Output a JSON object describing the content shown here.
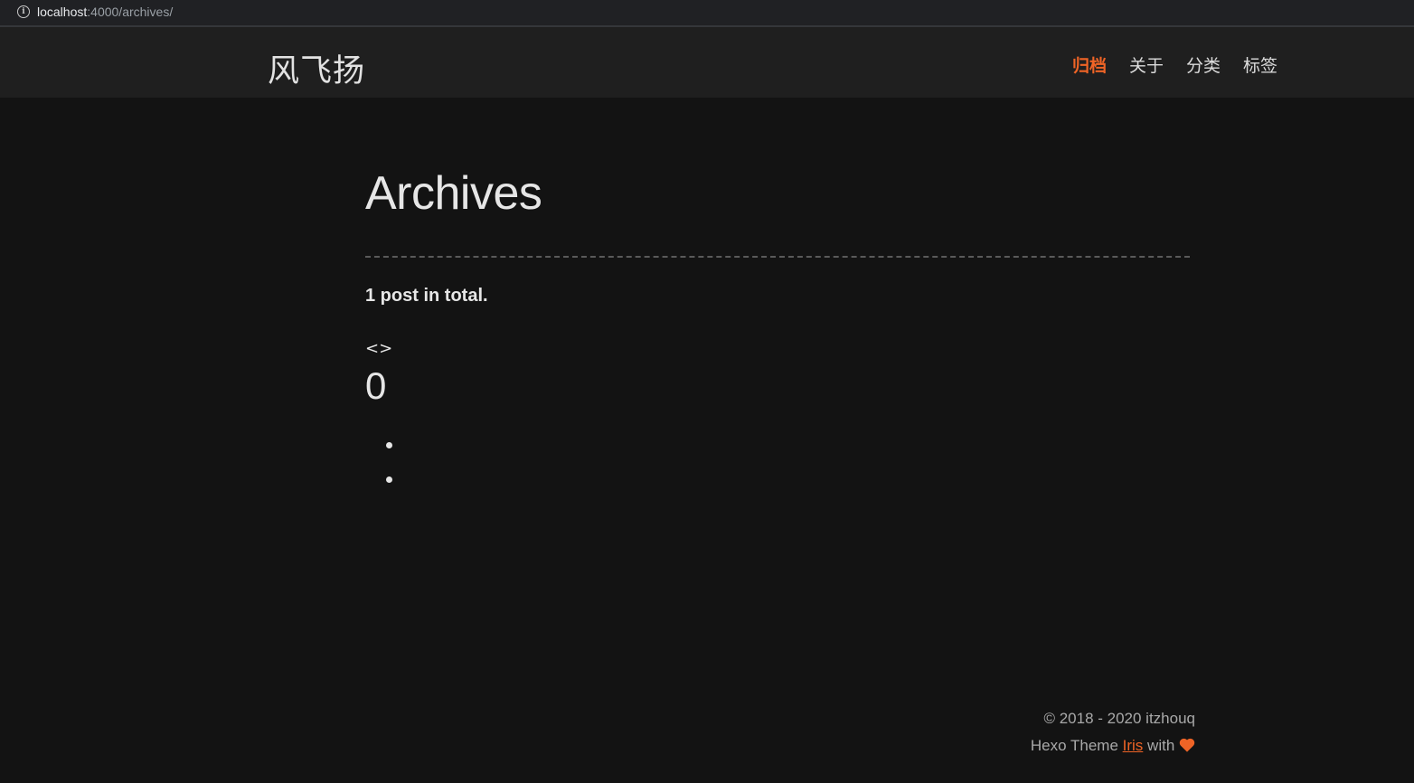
{
  "browser": {
    "url_host": "localhost",
    "url_rest": ":4000/archives/"
  },
  "header": {
    "site_title": "风飞扬",
    "nav": [
      {
        "label": "归档",
        "active": true
      },
      {
        "label": "关于",
        "active": false
      },
      {
        "label": "分类",
        "active": false
      },
      {
        "label": "标签",
        "active": false
      }
    ]
  },
  "main": {
    "title": "Archives",
    "total": "1 post in total.",
    "year_marker": "<>",
    "year_count": "0",
    "posts": [
      "",
      ""
    ]
  },
  "footer": {
    "copyright": "© 2018 - 2020 itzhouq",
    "theme_prefix": "Hexo Theme ",
    "theme_link": "Iris",
    "theme_suffix": " with ",
    "heart_icon": "heart-icon"
  },
  "colors": {
    "accent": "#ef6426",
    "background": "#131313",
    "navbar": "#1f1f1f"
  }
}
